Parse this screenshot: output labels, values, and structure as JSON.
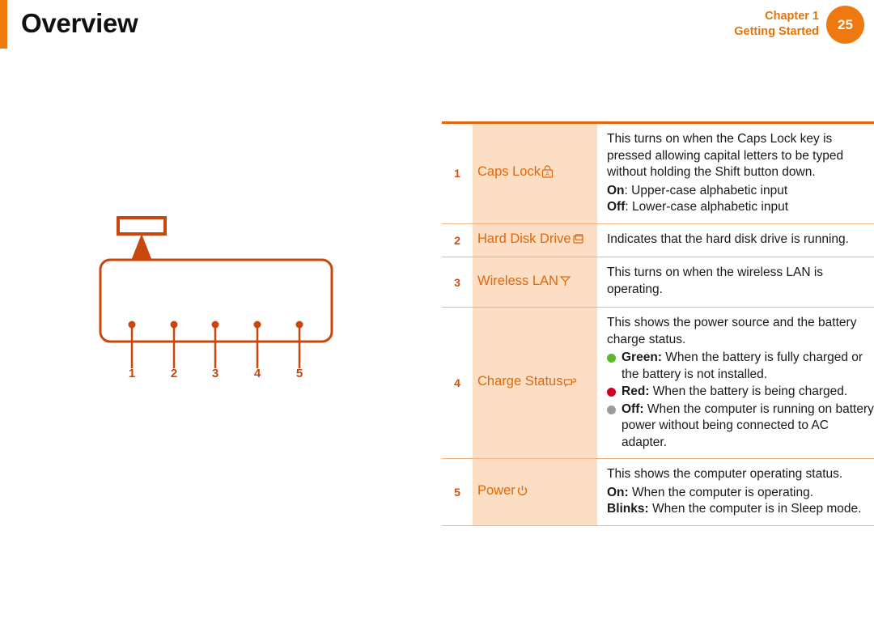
{
  "header": {
    "title": "Overview",
    "chapter_line1": "Chapter 1",
    "chapter_line2": "Getting Started",
    "page_number": "25",
    "accent_color": "#ED7B0E",
    "badge_color": "#EE7911"
  },
  "diagram": {
    "name": "status-indicator-lamps-diagram",
    "callout_numbers": [
      "1",
      "2",
      "3",
      "4",
      "5"
    ],
    "line_color": "#C9460D"
  },
  "table": {
    "border_color": "#E2670A",
    "row_separator_color": "#F6B27C",
    "label_bg": "#FBDEC4",
    "label_color": "#E2670A",
    "rows": [
      {
        "num": "1",
        "label": "Caps Lock",
        "icon": "caps-lock-icon",
        "desc_paragraph": "This turns on when the Caps Lock key is pressed allowing capital letters to be typed without holding the Shift button down.",
        "states": [
          {
            "bold": "On",
            "rest": ": Upper-case alphabetic input"
          },
          {
            "bold": "Off",
            "rest": ": Lower-case alphabetic input"
          }
        ]
      },
      {
        "num": "2",
        "label": "Hard Disk Drive",
        "icon": "hard-disk-drive-icon",
        "desc_paragraph": "Indicates that the hard disk drive is running.",
        "states": []
      },
      {
        "num": "3",
        "label": "Wireless LAN",
        "icon": "wireless-lan-icon",
        "desc_paragraph": "This turns on when the wireless LAN is operating.",
        "states": []
      },
      {
        "num": "4",
        "label": "Charge Status",
        "icon": "charge-status-icon",
        "desc_paragraph": "This shows the power source and the battery charge status.",
        "bullets": [
          {
            "color": "#5CB82E",
            "bold": "Green:",
            "rest": " When the battery is fully charged or the battery is not installed."
          },
          {
            "color": "#CC0022",
            "bold": "Red:",
            "rest": " When the battery is being charged."
          },
          {
            "color": "#9B9B9B",
            "bold": "Off:",
            "rest": " When the computer is running on battery power without being connected to AC adapter."
          }
        ]
      },
      {
        "num": "5",
        "label": "Power",
        "icon": "power-icon",
        "desc_paragraph": "This shows the computer operating status.",
        "states": [
          {
            "bold": "On:",
            "rest": " When the computer is operating."
          },
          {
            "bold": "Blinks:",
            "rest": " When the computer is in Sleep mode."
          }
        ]
      }
    ]
  }
}
